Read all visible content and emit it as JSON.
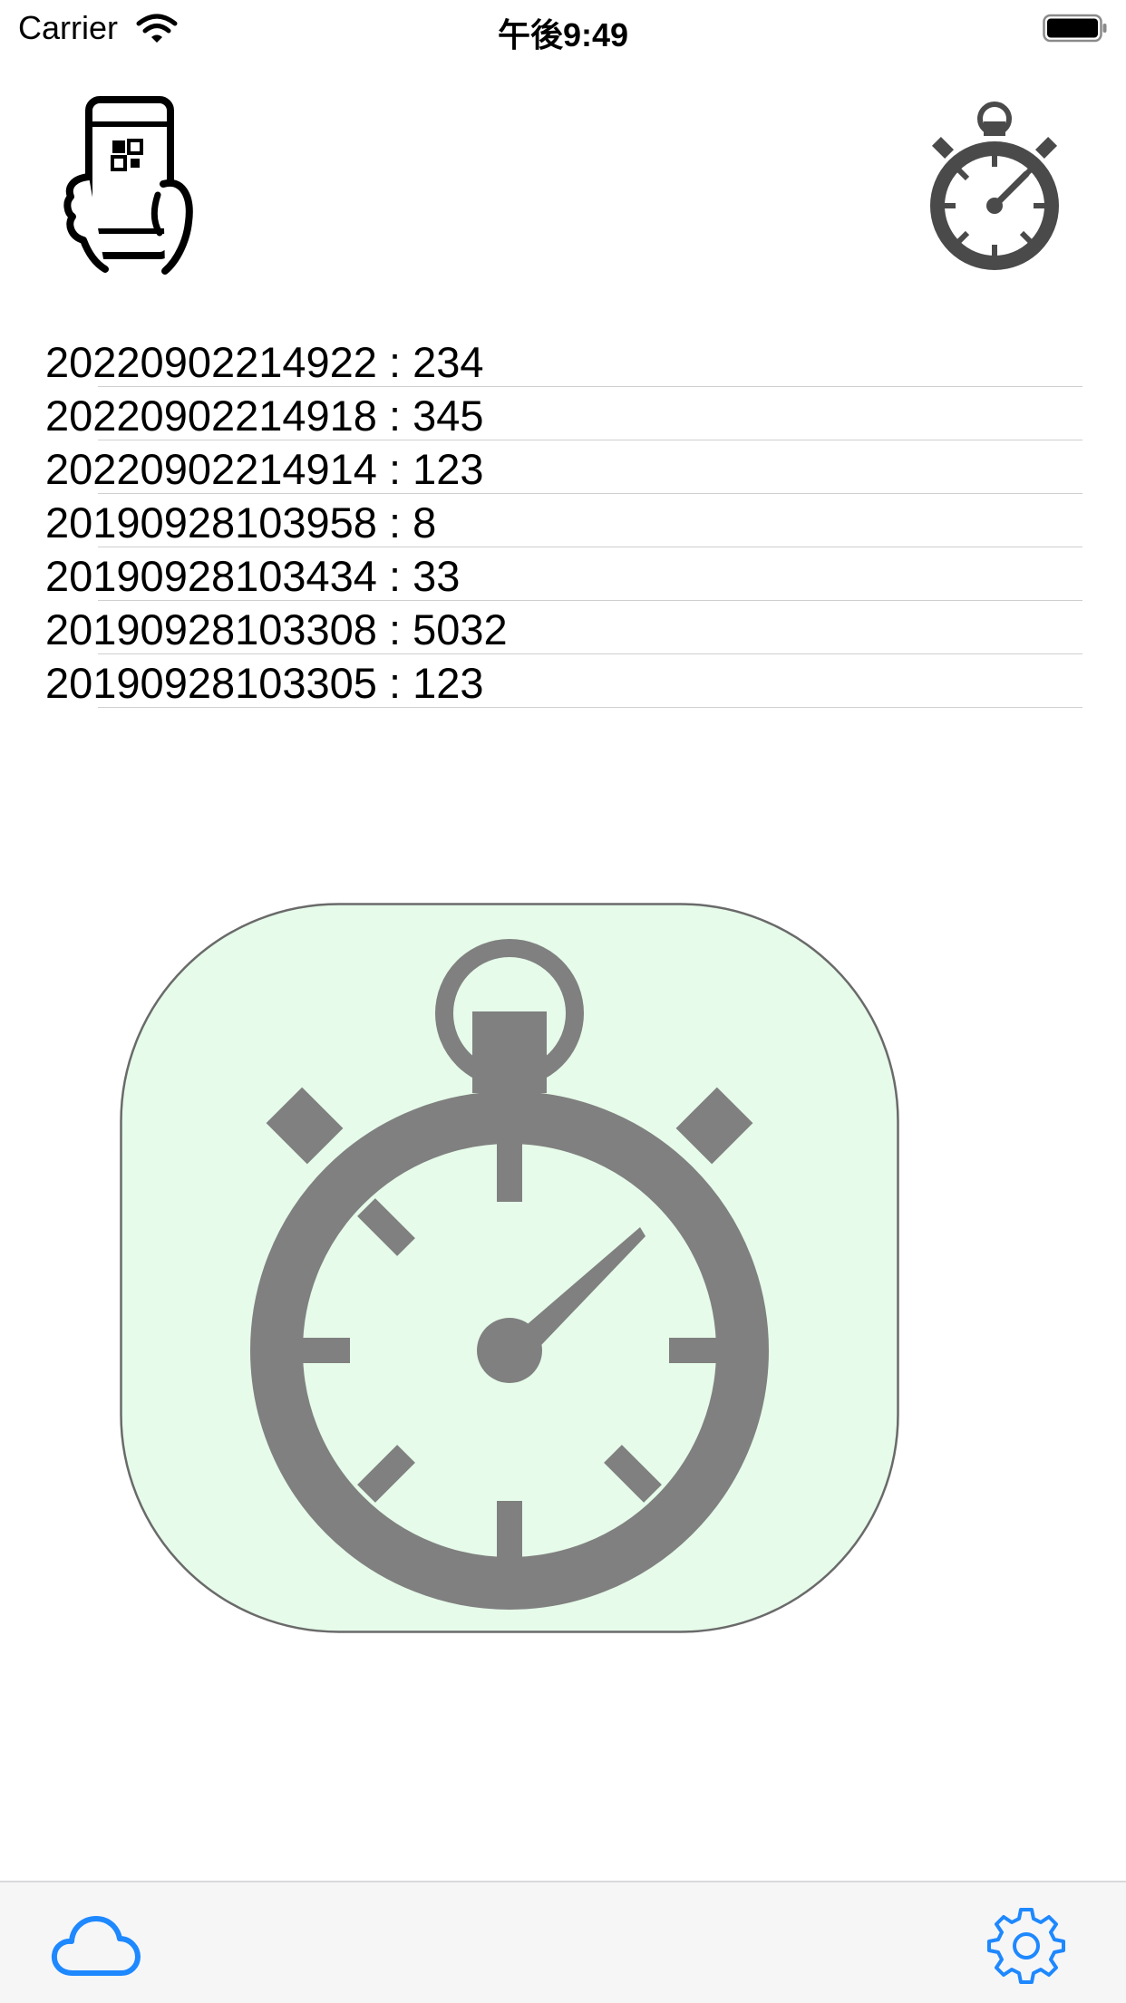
{
  "status_bar": {
    "carrier": "Carrier",
    "time": "午後9:49"
  },
  "records": [
    "20220902214922 : 234",
    "20220902214918 : 345",
    "20220902214914 : 123",
    "20190928103958 : 8",
    "20190928103434 : 33",
    "20190928103308 : 5032",
    "20190928103305 : 123"
  ],
  "icons": {
    "top_left": "phone-in-hand-qr-icon",
    "top_right": "stopwatch-icon",
    "main_button": "stopwatch-icon",
    "tab_left": "cloud-icon",
    "tab_right": "gear-icon"
  },
  "colors": {
    "button_fill": "#e6fbea",
    "button_icon": "#808080",
    "top_stopwatch": "#4a4a4a",
    "tab_tint": "#1e88ff",
    "separator": "#cfcfcf"
  }
}
